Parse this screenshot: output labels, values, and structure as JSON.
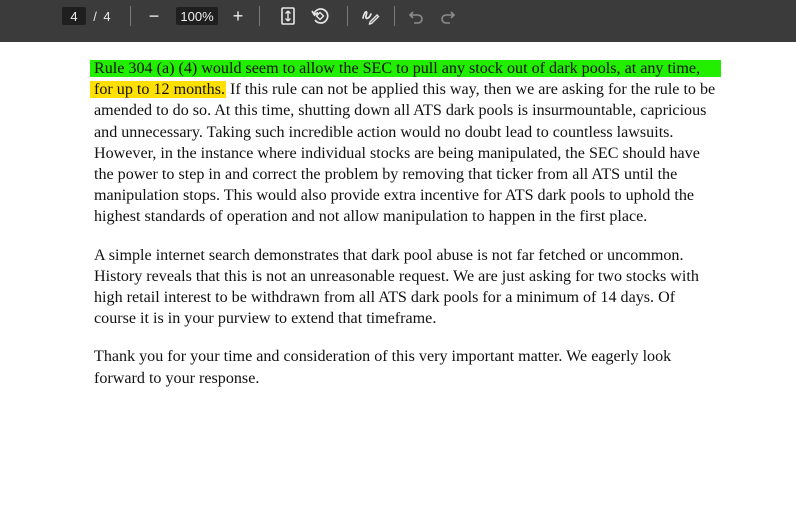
{
  "toolbar": {
    "page_current": "4",
    "page_separator": "/",
    "page_total": "4",
    "zoom_out_label": "−",
    "zoom_level": "100%",
    "zoom_in_label": "+",
    "icons": [
      "fit-page-icon",
      "rotate-icon",
      "annotate-icon",
      "undo-icon",
      "redo-icon"
    ]
  },
  "document": {
    "paragraphs": [
      {
        "lines": [
          {
            "segments": [
              {
                "text": "Rule 304 (a) (4) would seem to allow the SEC to pull any stock out of dark pools, at any time,",
                "highlight": "green"
              }
            ]
          },
          {
            "segments": [
              {
                "text": "for up to 12 months.",
                "highlight": "yellow"
              },
              {
                "text": " If this rule can not be applied this way, then we are asking for the rule to be"
              }
            ]
          },
          {
            "segments": [
              {
                "text": "amended to do so. At this time, shutting down all ATS dark pools is insurmountable, capricious"
              }
            ]
          },
          {
            "segments": [
              {
                "text": "and unnecessary. Taking such incredible action would no doubt lead to countless lawsuits."
              }
            ]
          },
          {
            "segments": [
              {
                "text": "However, in the instance where individual stocks are being manipulated, the SEC should have"
              }
            ]
          },
          {
            "segments": [
              {
                "text": "the power to step in and correct the problem by removing that ticker from all ATS until the"
              }
            ]
          },
          {
            "segments": [
              {
                "text": "manipulation stops. This would also provide extra incentive for ATS dark pools to uphold the"
              }
            ]
          },
          {
            "segments": [
              {
                "text": "highest standards of operation and not allow manipulation to happen in the first place."
              }
            ]
          }
        ]
      },
      {
        "lines": [
          {
            "segments": [
              {
                "text": "A simple internet search demonstrates that dark pool abuse is not far fetched or uncommon."
              }
            ]
          },
          {
            "segments": [
              {
                "text": "History reveals that this is not an unreasonable request. We are just asking for two stocks with"
              }
            ]
          },
          {
            "segments": [
              {
                "text": "high retail interest to be withdrawn from all ATS dark pools for a minimum of 14 days. Of"
              }
            ]
          },
          {
            "segments": [
              {
                "text": "course it is in your purview to extend that timeframe."
              }
            ]
          }
        ]
      },
      {
        "lines": [
          {
            "segments": [
              {
                "text": "Thank you for your time and consideration of this very important matter. We eagerly look"
              }
            ]
          },
          {
            "segments": [
              {
                "text": "forward to your response."
              }
            ]
          }
        ]
      }
    ]
  },
  "colors": {
    "toolbar_bg": "#3b3b3b",
    "highlight_green": "#22ee00",
    "highlight_yellow": "#ffe000"
  }
}
